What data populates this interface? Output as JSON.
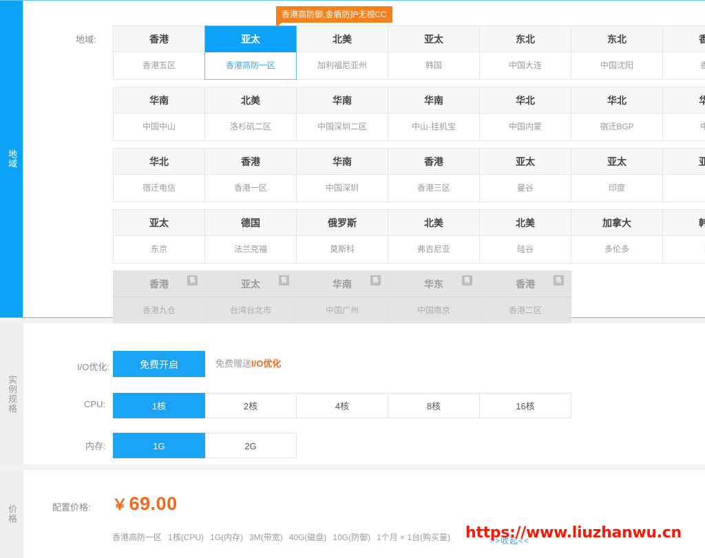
{
  "sections": {
    "region": {
      "tab_label": "地域",
      "row_label": "地域:",
      "tooltip": "香港高防御,金盾防护无视CC",
      "rows": [
        {
          "disabled": false,
          "cells": [
            {
              "region": "香港",
              "zone": "香港五区",
              "selected": false
            },
            {
              "region": "亚太",
              "zone": "香港高防一区",
              "selected": true
            },
            {
              "region": "北美",
              "zone": "加利福尼亚州",
              "selected": false
            },
            {
              "region": "亚太",
              "zone": "韩国",
              "selected": false
            },
            {
              "region": "东北",
              "zone": "中国大连",
              "selected": false
            },
            {
              "region": "东北",
              "zone": "中国沈阳",
              "selected": false
            },
            {
              "region": "香港",
              "zone": "香港",
              "selected": false
            }
          ]
        },
        {
          "disabled": false,
          "cells": [
            {
              "region": "华南",
              "zone": "中国中山",
              "selected": false
            },
            {
              "region": "北美",
              "zone": "洛杉矶二区",
              "selected": false
            },
            {
              "region": "华南",
              "zone": "中国深圳二区",
              "selected": false
            },
            {
              "region": "华南",
              "zone": "中山-挂机宝",
              "selected": false
            },
            {
              "region": "华北",
              "zone": "中国内蒙",
              "selected": false
            },
            {
              "region": "华北",
              "zone": "宿迁BGP",
              "selected": false
            },
            {
              "region": "华北",
              "zone": "中国",
              "selected": false
            }
          ]
        },
        {
          "disabled": false,
          "cells": [
            {
              "region": "华北",
              "zone": "宿迁电信",
              "selected": false
            },
            {
              "region": "香港",
              "zone": "香港一区",
              "selected": false
            },
            {
              "region": "华南",
              "zone": "中国深圳",
              "selected": false
            },
            {
              "region": "香港",
              "zone": "香港三区",
              "selected": false
            },
            {
              "region": "亚太",
              "zone": "曼谷",
              "selected": false
            },
            {
              "region": "亚太",
              "zone": "印度",
              "selected": false
            },
            {
              "region": "亚太",
              "zone": "首",
              "selected": false
            }
          ]
        },
        {
          "disabled": false,
          "cells": [
            {
              "region": "亚太",
              "zone": "东京",
              "selected": false
            },
            {
              "region": "德国",
              "zone": "法兰克福",
              "selected": false
            },
            {
              "region": "俄罗斯",
              "zone": "莫斯科",
              "selected": false
            },
            {
              "region": "北美",
              "zone": "弗吉尼亚",
              "selected": false
            },
            {
              "region": "北美",
              "zone": "硅谷",
              "selected": false
            },
            {
              "region": "加拿大",
              "zone": "多伦多",
              "selected": false
            },
            {
              "region": "韩国",
              "zone": "韩",
              "selected": false
            }
          ]
        },
        {
          "disabled": true,
          "cells": [
            {
              "region": "香港",
              "zone": "香港九仓",
              "selected": false,
              "badge": "售罄"
            },
            {
              "region": "亚太",
              "zone": "台湾台北市",
              "selected": false,
              "badge": "售罄"
            },
            {
              "region": "华南",
              "zone": "中国广州",
              "selected": false,
              "badge": "售罄"
            },
            {
              "region": "华东",
              "zone": "中国南京",
              "selected": false,
              "badge": "售罄"
            },
            {
              "region": "香港",
              "zone": "香港二区",
              "selected": false,
              "badge": "售罄"
            }
          ]
        }
      ]
    },
    "spec": {
      "tab_label": "实例规格",
      "io": {
        "label": "I/O优化:",
        "options": [
          {
            "label": "免费开启",
            "selected": true
          }
        ],
        "note_prefix": "免费赠送",
        "note_highlight": "I/O优化"
      },
      "cpu": {
        "label": "CPU:",
        "options": [
          {
            "label": "1核",
            "selected": true
          },
          {
            "label": "2核",
            "selected": false
          },
          {
            "label": "4核",
            "selected": false
          },
          {
            "label": "8核",
            "selected": false
          },
          {
            "label": "16核",
            "selected": false
          }
        ]
      },
      "memory": {
        "label": "内存:",
        "options": [
          {
            "label": "1G",
            "selected": true
          },
          {
            "label": "2G",
            "selected": false
          }
        ]
      }
    },
    "price": {
      "tab_label": "价格",
      "label": "配置价格:",
      "currency": "￥",
      "amount": "69.00",
      "summary": [
        "香港高防一区",
        "1核(CPU)",
        "1G(内存)",
        "3M(带宽)",
        "40G(磁盘)",
        "10G(防御)",
        "1个月 × 1台(购买量)"
      ],
      "collapse_label": ">>收起<<"
    }
  },
  "watermark": "https://www.liuzhanwu.cn",
  "colors": {
    "accent_blue": "#0ca2f7",
    "accent_orange": "#f4671f",
    "tooltip_orange": "#f4801e",
    "watermark_red": "#fd1606"
  }
}
